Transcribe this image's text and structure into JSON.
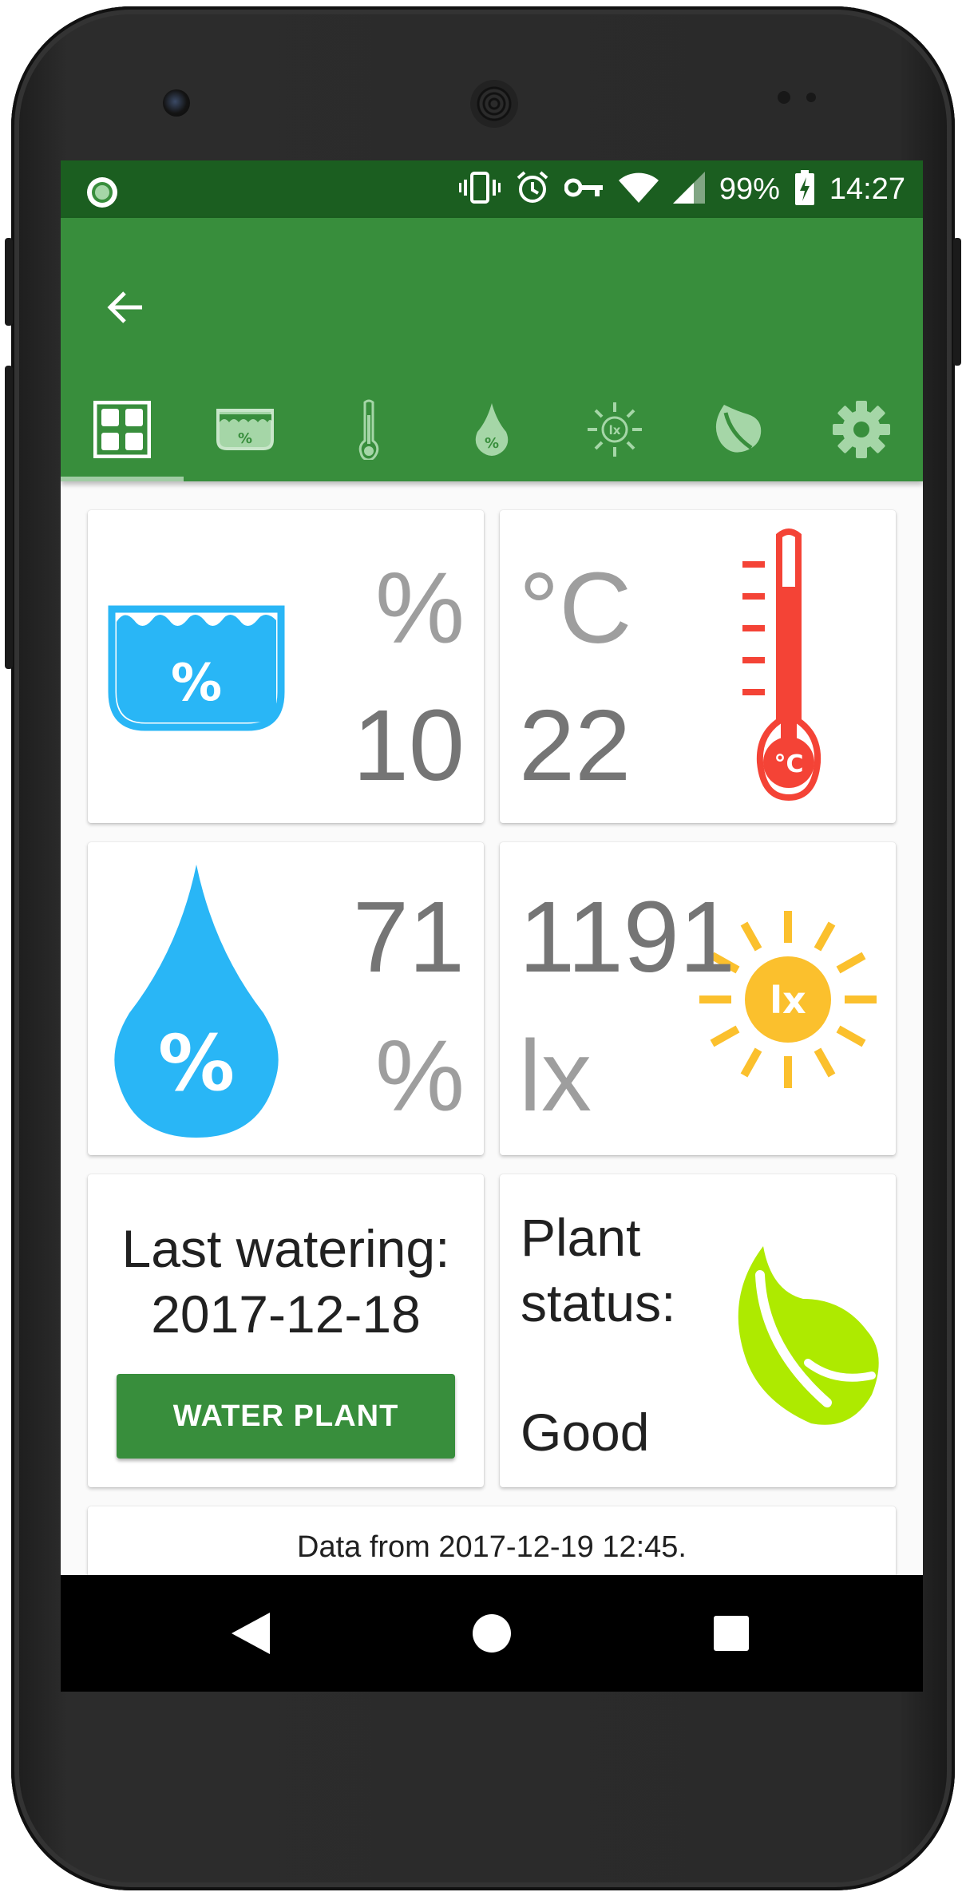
{
  "status_bar": {
    "battery": "99%",
    "time": "14:27"
  },
  "toolbar": {
    "tabs": [
      {
        "name": "dashboard-icon"
      },
      {
        "name": "soil-moisture-icon"
      },
      {
        "name": "thermometer-icon"
      },
      {
        "name": "humidity-drop-icon"
      },
      {
        "name": "light-sun-icon"
      },
      {
        "name": "plant-leaf-icon"
      },
      {
        "name": "settings-gear-icon"
      }
    ]
  },
  "cards": {
    "soil_moisture": {
      "value": "10",
      "unit": "%",
      "icon_label": "%"
    },
    "temperature": {
      "value": "22",
      "unit": "°C",
      "icon_label": "°C"
    },
    "humidity": {
      "value": "71",
      "unit": "%",
      "icon_label": "%"
    },
    "light": {
      "value": "1191",
      "unit": "lx",
      "icon_label": "lx"
    },
    "watering": {
      "title": "Last watering:",
      "date": "2017-12-18",
      "button_label": "WATER PLANT"
    },
    "plant_status": {
      "title_line1": "Plant",
      "title_line2": "status:",
      "value": "Good"
    },
    "footer": {
      "text": "Data from 2017-12-19 12:45."
    }
  },
  "colors": {
    "status_bar": "#1b5e20",
    "app_bar": "#388e3c",
    "soil_blue": "#29b6f6",
    "thermo_red": "#f44336",
    "sun_yellow": "#fbc02d",
    "leaf_green": "#aeea00"
  }
}
